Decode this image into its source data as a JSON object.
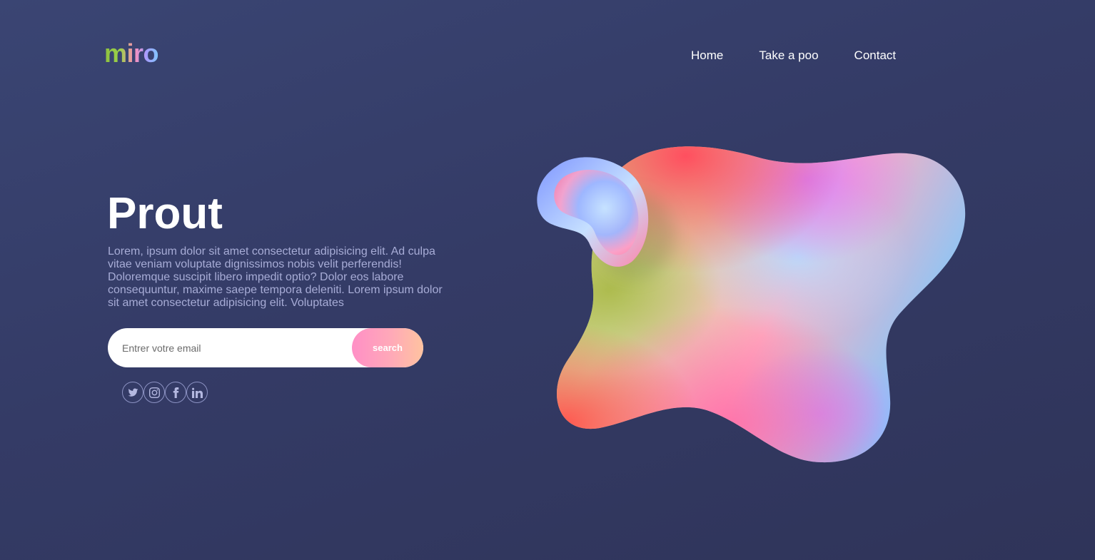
{
  "header": {
    "logo": "miro",
    "nav": [
      {
        "label": "Home"
      },
      {
        "label": "Take a poo"
      },
      {
        "label": "Contact"
      }
    ]
  },
  "hero": {
    "title": "Prout",
    "text": "Lorem, ipsum dolor sit amet consectetur adipisicing elit. Ad culpa vitae veniam voluptate dignissimos nobis velit perferendis! Doloremque suscipit libero impedit optio? Dolor eos labore consequuntur, maxime saepe tempora deleniti. Lorem ipsum dolor sit amet consectetur adipisicing elit. Voluptates"
  },
  "search": {
    "placeholder": "Entrer votre email",
    "button_label": "search"
  },
  "socials": [
    {
      "icon": "twitter-icon"
    },
    {
      "icon": "instagram-icon"
    },
    {
      "icon": "facebook-icon"
    },
    {
      "icon": "linkedin-icon"
    }
  ],
  "colors": {
    "background": "#363d6a",
    "text_muted": "#a7acd6",
    "button_gradient_start": "#ff8fc6",
    "button_gradient_end": "#ffc3a0"
  }
}
